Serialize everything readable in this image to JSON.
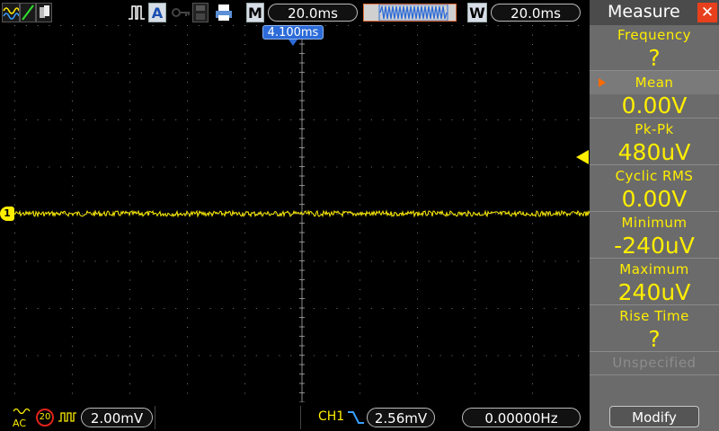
{
  "colors": {
    "trace": "#ffee00",
    "grid_dots": "#7a7a7a",
    "trigger_marker": "#2c6bd8",
    "panel_bg": "#6b6b6b",
    "close": "#e8401c"
  },
  "topbar": {
    "auto_label": "A",
    "memory_label": "M",
    "timebase": "20.0ms",
    "window_label": "W",
    "window_timebase": "20.0ms",
    "trigger_position": "4.100ms"
  },
  "channel": {
    "marker": "1",
    "coupling": "AC",
    "bw_limit": "20",
    "volts_div": "2.00mV"
  },
  "trigger": {
    "source": "CH1",
    "level": "2.56mV",
    "frequency": "0.00000Hz"
  },
  "measure": {
    "title": "Measure",
    "close_icon": "close-icon",
    "items": [
      {
        "label": "Frequency",
        "value": "?"
      },
      {
        "label": "Mean",
        "value": "0.00V",
        "selected": true
      },
      {
        "label": "Pk-Pk",
        "value": "480uV"
      },
      {
        "label": "Cyclic RMS",
        "value": "0.00V"
      },
      {
        "label": "Minimum",
        "value": "-240uV"
      },
      {
        "label": "Maximum",
        "value": "240uV"
      },
      {
        "label": "Rise Time",
        "value": "?"
      }
    ],
    "unspecified": "Unspecified",
    "modify_label": "Modify"
  }
}
